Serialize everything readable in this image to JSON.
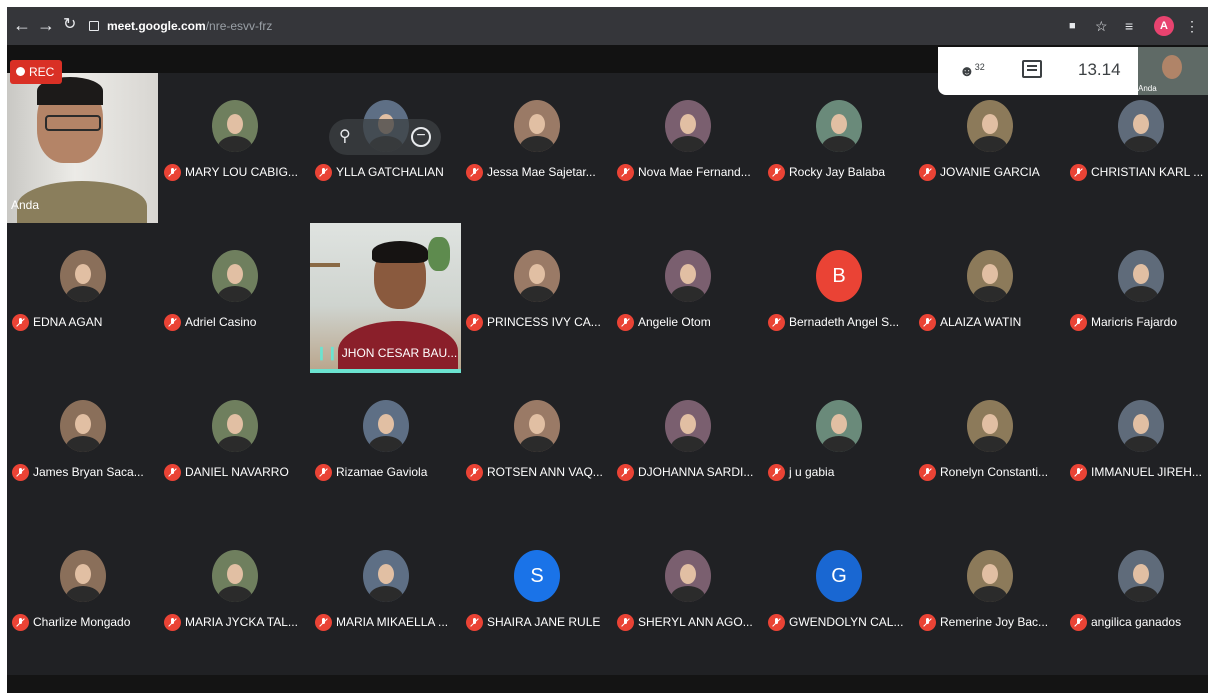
{
  "browser": {
    "url_host": "meet.google.com",
    "url_path": "/nre-esvv-frz",
    "profile_initial": "A"
  },
  "meet": {
    "rec_label": "REC",
    "participant_count": "32",
    "time": "13.14",
    "self_view_name": "Anda"
  },
  "tiles": [
    {
      "name": "Anda",
      "video": "anda"
    },
    {
      "name": "MARY LOU CABIG...",
      "avatar": "photo",
      "muted": true
    },
    {
      "name": "YLLA GATCHALIAN",
      "avatar": "photo",
      "muted": true,
      "hover": true
    },
    {
      "name": "Jessa Mae Sajetar...",
      "avatar": "photo",
      "muted": true
    },
    {
      "name": "Nova Mae Fernand...",
      "avatar": "photo",
      "muted": true
    },
    {
      "name": "Rocky Jay Balaba",
      "avatar": "photo",
      "muted": true
    },
    {
      "name": "JOVANIE GARCIA",
      "avatar": "photo",
      "muted": true
    },
    {
      "name": "CHRISTIAN KARL ...",
      "avatar": "photo",
      "muted": true
    },
    {
      "name": "EDNA AGAN",
      "avatar": "photo",
      "muted": true
    },
    {
      "name": "Adriel Casino",
      "avatar": "photo",
      "muted": true
    },
    {
      "name": "JHON CESAR BAU...",
      "video": "jhon",
      "speaking": true
    },
    {
      "name": "PRINCESS IVY CA...",
      "avatar": "photo",
      "muted": true
    },
    {
      "name": "Angelie Otom",
      "avatar": "photo",
      "muted": true
    },
    {
      "name": "Bernadeth Angel S...",
      "avatar": "letter",
      "letter": "B",
      "color": "#ea4335",
      "muted": true
    },
    {
      "name": "ALAIZA WATIN",
      "avatar": "photo",
      "muted": true
    },
    {
      "name": "Maricris Fajardo",
      "avatar": "photo",
      "muted": true
    },
    {
      "name": "James Bryan Saca...",
      "avatar": "photo",
      "muted": true
    },
    {
      "name": "DANIEL NAVARRO",
      "avatar": "photo",
      "muted": true
    },
    {
      "name": "Rizamae Gaviola",
      "avatar": "photo",
      "muted": true
    },
    {
      "name": "ROTSEN ANN VAQ...",
      "avatar": "photo",
      "muted": true
    },
    {
      "name": "DJOHANNA SARDI...",
      "avatar": "photo",
      "muted": true
    },
    {
      "name": "j u gabia",
      "avatar": "photo",
      "muted": true
    },
    {
      "name": "Ronelyn Constanti...",
      "avatar": "photo",
      "muted": true
    },
    {
      "name": "IMMANUEL JIREH...",
      "avatar": "photo",
      "muted": true
    },
    {
      "name": "Charlize Mongado",
      "avatar": "photo",
      "muted": true
    },
    {
      "name": "MARIA JYCKA TAL...",
      "avatar": "photo",
      "muted": true
    },
    {
      "name": "MARIA MIKAELLA ...",
      "avatar": "photo",
      "muted": true
    },
    {
      "name": "SHAIRA JANE RULE",
      "avatar": "letter",
      "letter": "S",
      "color": "#1a73e8",
      "muted": true
    },
    {
      "name": "SHERYL ANN AGO...",
      "avatar": "photo",
      "muted": true
    },
    {
      "name": "GWENDOLYN CAL...",
      "avatar": "letter",
      "letter": "G",
      "color": "#1967d2",
      "muted": true
    },
    {
      "name": "Remerine Joy Bac...",
      "avatar": "photo",
      "muted": true
    },
    {
      "name": "angilica ganados",
      "avatar": "photo",
      "muted": true
    }
  ]
}
